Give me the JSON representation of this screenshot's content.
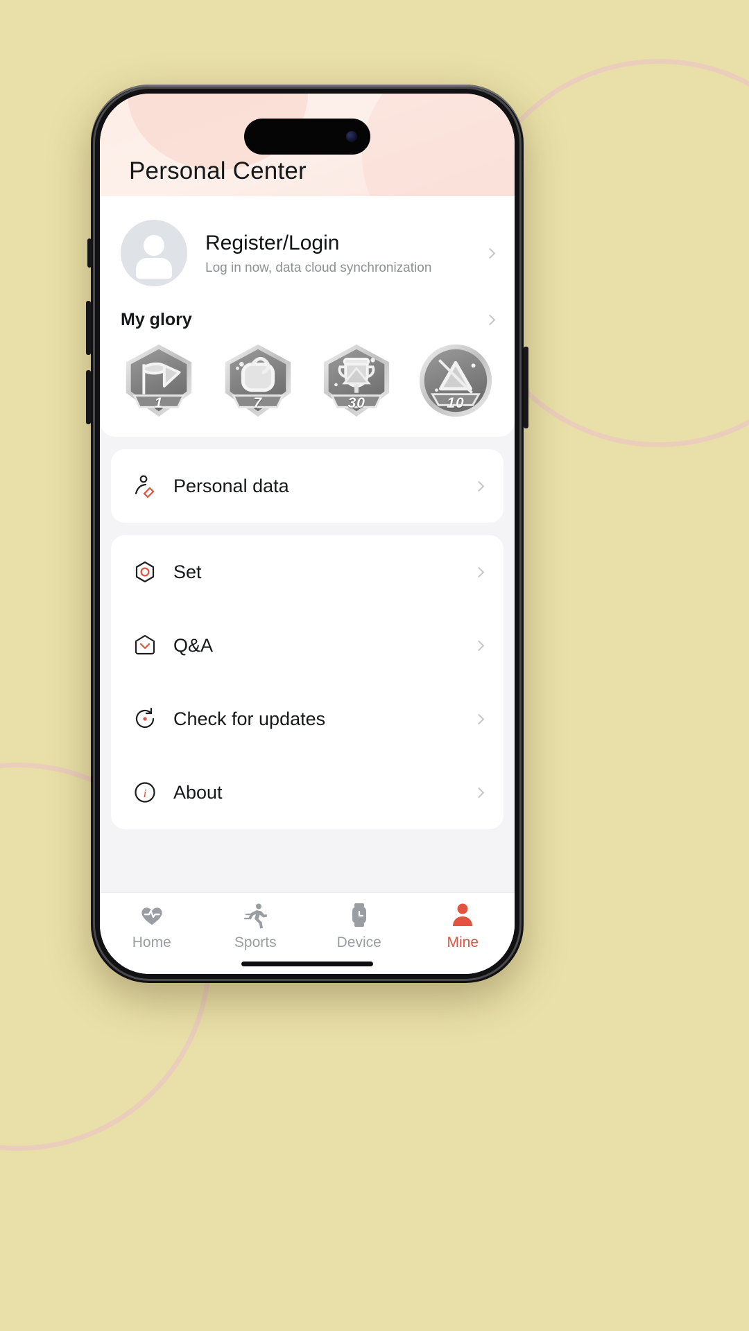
{
  "header": {
    "title": "Personal Center"
  },
  "profile": {
    "name": "Register/Login",
    "subtitle": "Log in now, data cloud synchronization",
    "avatar_icon": "person-avatar-icon",
    "chevron_icon": "chevron-right-icon"
  },
  "glory": {
    "title": "My glory",
    "chevron_icon": "chevron-right-icon",
    "medals": [
      {
        "number": "1",
        "icon": "medal-flag-icon"
      },
      {
        "number": "7",
        "icon": "medal-shoe-icon"
      },
      {
        "number": "30",
        "icon": "medal-trophy-icon"
      },
      {
        "number": "10",
        "icon": "medal-circle-icon"
      }
    ]
  },
  "menu": {
    "group1": [
      {
        "label": "Personal data",
        "icon": "person-edit-icon"
      }
    ],
    "group2": [
      {
        "label": "Set",
        "icon": "settings-hexagon-icon"
      },
      {
        "label": "Q&A",
        "icon": "question-chat-icon"
      },
      {
        "label": "Check for updates",
        "icon": "refresh-update-icon"
      },
      {
        "label": "About",
        "icon": "info-circle-icon"
      }
    ]
  },
  "tabbar": {
    "tabs": [
      {
        "label": "Home",
        "icon": "heart-pulse-icon",
        "active": false
      },
      {
        "label": "Sports",
        "icon": "running-person-icon",
        "active": false
      },
      {
        "label": "Device",
        "icon": "smartwatch-icon",
        "active": false
      },
      {
        "label": "Mine",
        "icon": "user-profile-icon",
        "active": true
      }
    ]
  },
  "colors": {
    "accent": "#e3533f",
    "page_bg": "#e9dfa8",
    "header_bg": "#fdeee7",
    "card_bg": "#ffffff",
    "muted_text": "#8d9095"
  }
}
